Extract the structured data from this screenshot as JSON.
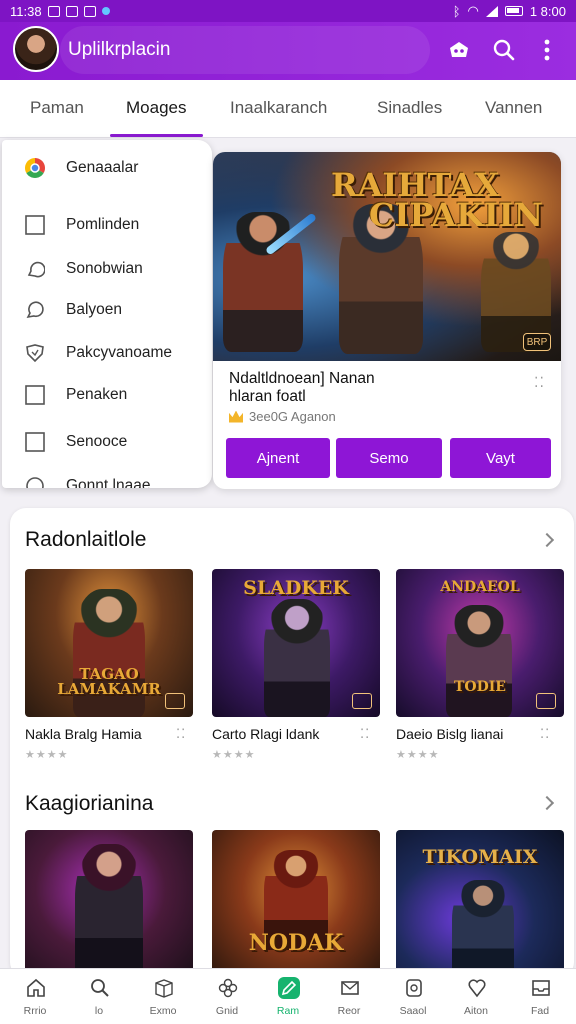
{
  "status_bar": {
    "time": "11:38",
    "right_time": "1 8:00"
  },
  "app_bar": {
    "title": "Uplilkrplacin",
    "icons": [
      "controller-icon",
      "search-icon",
      "more-vertical-icon"
    ]
  },
  "tabs": [
    {
      "label": "Paman",
      "active": false
    },
    {
      "label": "Moages",
      "active": true
    },
    {
      "label": "Inaalkaranch",
      "active": false
    },
    {
      "label": "Sinadles",
      "active": false
    },
    {
      "label": "Vannen",
      "active": false
    }
  ],
  "side_menu": {
    "items": [
      {
        "label": "Genaaalar",
        "icon": "chrome-icon"
      },
      {
        "label": "Pomlinden",
        "icon": "square-icon"
      },
      {
        "label": "Sonobwian",
        "icon": "chat-icon"
      },
      {
        "label": "Balyoen",
        "icon": "chat-bubble-icon"
      },
      {
        "label": "Pakcyvanoame",
        "icon": "shield-icon"
      },
      {
        "label": "Penaken",
        "icon": "square-icon"
      },
      {
        "label": "Senooce",
        "icon": "square-icon"
      },
      {
        "label": "Gonnt lnaae",
        "icon": "circle-icon"
      }
    ]
  },
  "featured": {
    "art_title_line1": "RAIHTAX",
    "art_title_line2": "CIPAKIIN",
    "art_badge": "BRP",
    "title_line1": "Ndaltldnoean] Nanan",
    "title_line2": "hlaran foatl",
    "meta": "3ee0G Aganon",
    "buttons": [
      "Ajnent",
      "Semo",
      "Vayt"
    ]
  },
  "section1": {
    "title": "Radonlaitlole",
    "games": [
      {
        "name": "Nakla Bralg Hamia",
        "logo_line1": "TAGAO",
        "logo_line2": "LAMAKAMR",
        "stars": "★★★★"
      },
      {
        "name": "Carto Rlagi ldank",
        "logo_line1": "SLADKEK",
        "logo_line2": "",
        "stars": "★★★★"
      },
      {
        "name": "Daeio Bislg lianai",
        "logo_line1": "ANDAEOL",
        "logo_line2": "TODIE",
        "stars": "★★★★"
      }
    ]
  },
  "section2": {
    "title": "Kaagiorianina",
    "games": [
      {
        "logo_line1": ""
      },
      {
        "logo_line1": "NODAK"
      },
      {
        "logo_line1": "TIKOMAIX"
      }
    ]
  },
  "bottom_nav": [
    {
      "label": "Rrrio",
      "icon": "home-icon",
      "active": false
    },
    {
      "label": "lo",
      "icon": "search-icon",
      "active": false
    },
    {
      "label": "Exmo",
      "icon": "box-icon",
      "active": false
    },
    {
      "label": "Gnid",
      "icon": "flower-icon",
      "active": false
    },
    {
      "label": "Ram",
      "icon": "edit-icon",
      "active": true
    },
    {
      "label": "Reor",
      "icon": "mail-icon",
      "active": false
    },
    {
      "label": "Saaol",
      "icon": "device-icon",
      "active": false
    },
    {
      "label": "Aiton",
      "icon": "heart-icon",
      "active": false
    },
    {
      "label": "Fad",
      "icon": "inbox-icon",
      "active": false
    }
  ],
  "colors": {
    "accent": "#8e16d6",
    "app_bar": "#8a1ad0",
    "nav_active": "#16b36e"
  }
}
